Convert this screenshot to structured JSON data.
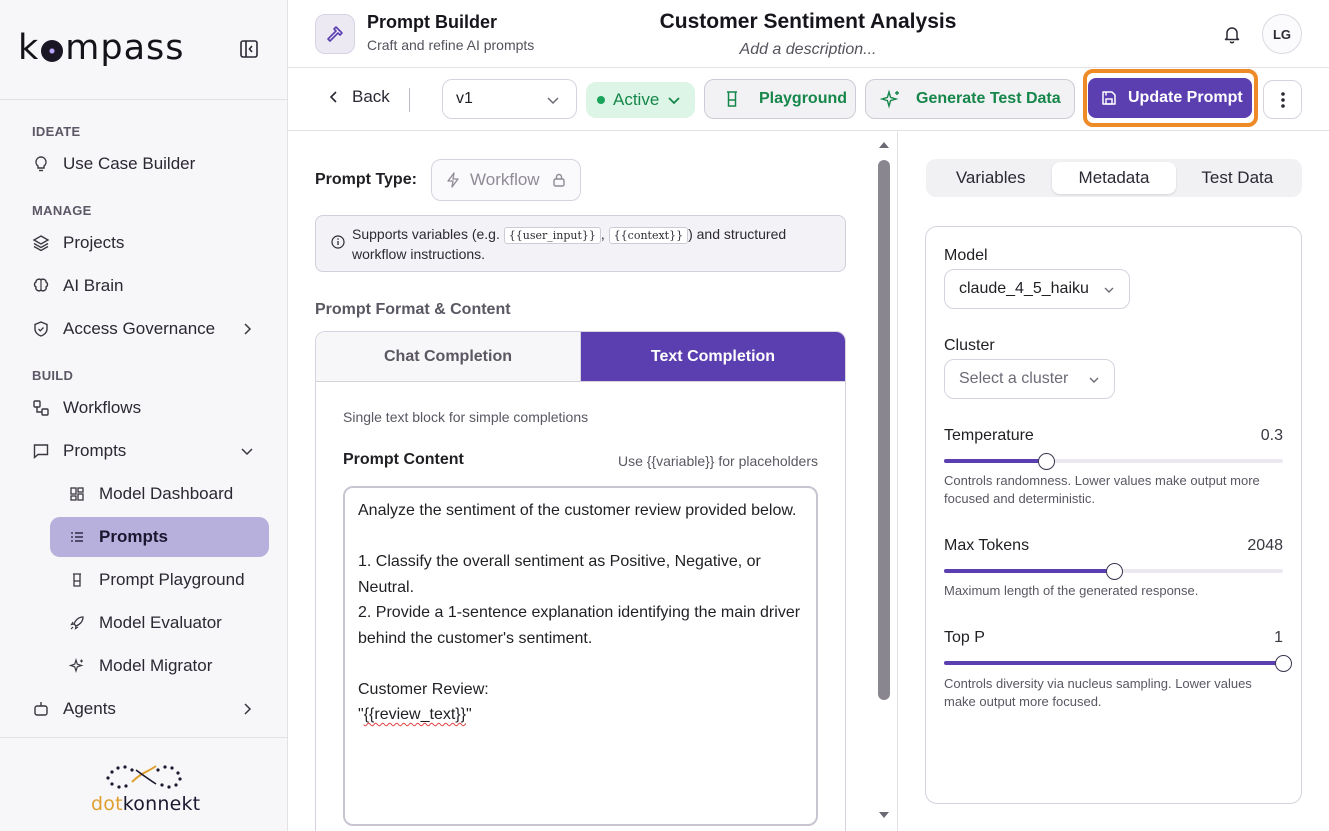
{
  "sidebar": {
    "logo": "kompass",
    "sections": {
      "ideate": "IDEATE",
      "manage": "MANAGE",
      "build": "BUILD"
    },
    "items": {
      "use_case_builder": "Use Case Builder",
      "projects": "Projects",
      "ai_brain": "AI Brain",
      "access_governance": "Access Governance",
      "workflows": "Workflows",
      "prompts": "Prompts",
      "model_dashboard": "Model Dashboard",
      "prompts_sub": "Prompts",
      "prompt_playground": "Prompt Playground",
      "model_evaluator": "Model Evaluator",
      "model_migrator": "Model Migrator",
      "agents": "Agents"
    },
    "footer_brand": {
      "prefix": "dot",
      "suffix": "konnekt"
    }
  },
  "header": {
    "app_title": "Prompt Builder",
    "app_subtitle": "Craft and refine AI prompts",
    "doc_title": "Customer Sentiment Analysis",
    "doc_description": "Add a description...",
    "avatar_initials": "LG"
  },
  "toolbar": {
    "back_label": "Back",
    "version": "v1",
    "status": "Active",
    "playground_label": "Playground",
    "generate_label": "Generate Test Data",
    "update_label": "Update Prompt"
  },
  "editor": {
    "prompt_type_label": "Prompt Type:",
    "prompt_type_value": "Workflow",
    "info_prefix": "Supports variables (e.g.",
    "info_code_1": "{{user_input}}",
    "info_sep": ",",
    "info_code_2": "{{context}}",
    "info_suffix": ") and structured workflow instructions.",
    "format_label": "Prompt Format & Content",
    "tabs": {
      "chat": "Chat Completion",
      "text": "Text Completion"
    },
    "format_help": "Single text block for simple completions",
    "content_label": "Prompt Content",
    "content_hint": "Use {{variable}} for placeholders",
    "content_before": "Analyze the sentiment of the customer review provided below.\n\n1. Classify the overall sentiment as Positive, Negative, or Neutral.\n2. Provide a 1-sentence explanation identifying the main driver behind the customer's sentiment.\n\nCustomer Review:\n\"",
    "content_var": "{{review_text}}",
    "content_after": "\""
  },
  "right_panel": {
    "tabs": {
      "variables": "Variables",
      "metadata": "Metadata",
      "test_data": "Test Data"
    },
    "model_label": "Model",
    "model_value": "claude_4_5_haiku",
    "cluster_label": "Cluster",
    "cluster_placeholder": "Select a cluster",
    "temperature": {
      "label": "Temperature",
      "value": "0.3",
      "fraction": 0.3,
      "help": "Controls randomness. Lower values make output more focused and deterministic."
    },
    "max_tokens": {
      "label": "Max Tokens",
      "value": "2048",
      "fraction": 0.5,
      "help": "Maximum length of the generated response."
    },
    "top_p": {
      "label": "Top P",
      "value": "1",
      "fraction": 1.0,
      "help": "Controls diversity via nucleus sampling. Lower values make output more focused."
    }
  },
  "colors": {
    "accent": "#5b3fb0",
    "active_green": "#16874a",
    "highlight_ring": "#ee8a27",
    "sidebar_active": "#b8b0dc"
  },
  "icons": {
    "collapse": "sidebar-collapse-icon",
    "bell": "bell-icon",
    "hammer": "hammer-icon",
    "save": "save-icon",
    "more": "more-vertical-icon"
  }
}
